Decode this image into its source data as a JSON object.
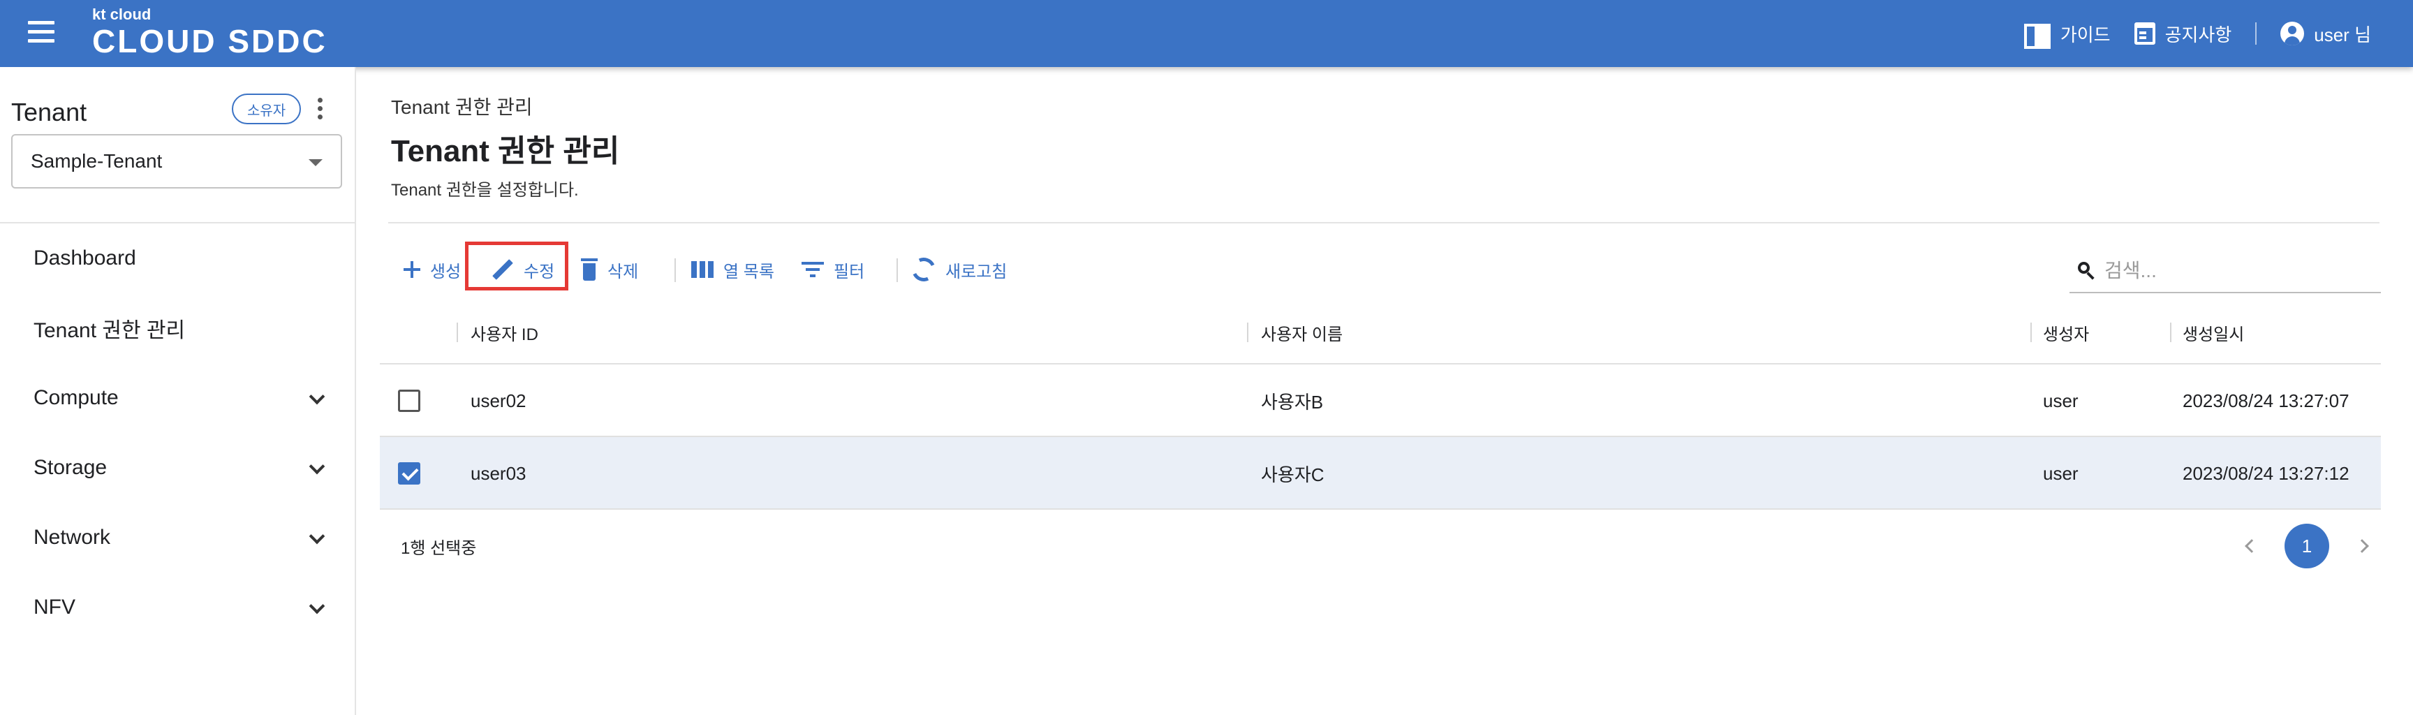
{
  "header": {
    "logo_small": "kt cloud",
    "logo_main": "CLOUD SDDC",
    "guide_label": "가이드",
    "notice_label": "공지사항",
    "user_label": "user 님",
    "bar_color": "#3b73c5"
  },
  "sidebar": {
    "title": "Tenant",
    "owner_badge": "소유자",
    "tenant_select_value": "Sample-Tenant",
    "items": [
      {
        "label": "Dashboard",
        "expandable": false
      },
      {
        "label": "Tenant 권한 관리",
        "expandable": false
      },
      {
        "label": "Compute",
        "expandable": true
      },
      {
        "label": "Storage",
        "expandable": true
      },
      {
        "label": "Network",
        "expandable": true
      },
      {
        "label": "NFV",
        "expandable": true
      }
    ]
  },
  "main": {
    "breadcrumb": "Tenant 권한 관리",
    "title": "Tenant 권한 관리",
    "description": "Tenant 권한을 설정합니다.",
    "toolbar": {
      "create": "생성",
      "edit": "수정",
      "delete": "삭제",
      "columns": "열 목록",
      "filter": "필터",
      "refresh": "새로고침"
    },
    "search": {
      "placeholder": "검색..."
    },
    "table": {
      "columns": [
        "사용자 ID",
        "사용자 이름",
        "생성자",
        "생성일시"
      ],
      "rows": [
        {
          "user_id": "user02",
          "user_name": "사용자B",
          "creator": "user",
          "created_at": "2023/08/24 13:27:07",
          "checked": false
        },
        {
          "user_id": "user03",
          "user_name": "사용자C",
          "creator": "user",
          "created_at": "2023/08/24 13:27:12",
          "checked": true
        }
      ],
      "selection_text": "1행 선택중",
      "current_page": "1"
    },
    "highlight_color": "#e53935"
  }
}
